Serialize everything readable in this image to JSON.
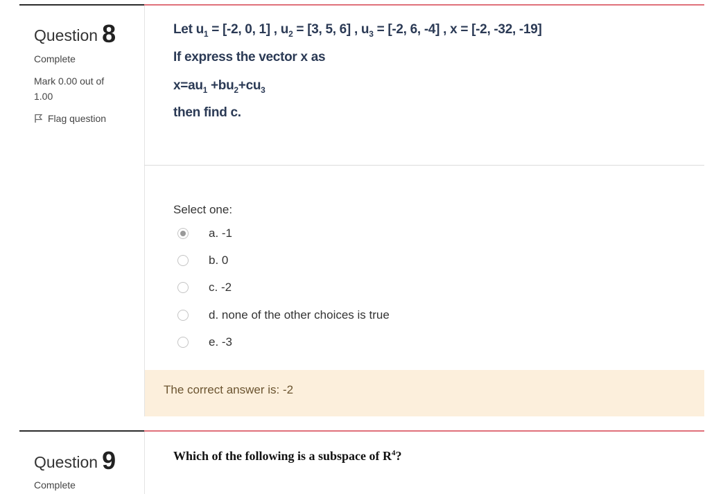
{
  "question8": {
    "label": "Question",
    "number": "8",
    "status": "Complete",
    "mark": "Mark 0.00 out of",
    "mark_total": "1.00",
    "flag_label": "Flag question",
    "text": {
      "line1_prefix": "Let u",
      "line1_sub1": "1",
      "line1_mid1": " = [-2, 0, 1] , u",
      "line1_sub2": "2",
      "line1_mid2": " = [3, 5, 6] , u",
      "line1_sub3": "3",
      "line1_mid3": " = [-2, 6, -4] , x = [-2, -32, -19]",
      "line2": "If express the vector x as",
      "line3_a": "x=au",
      "line3_sub1": "1",
      "line3_b": " +bu",
      "line3_sub2": "2",
      "line3_c": "+cu",
      "line3_sub3": "3",
      "line4": "then find c."
    },
    "select_prompt": "Select one:",
    "options": [
      {
        "label": "a. -1",
        "checked": true
      },
      {
        "label": "b. 0",
        "checked": false
      },
      {
        "label": "c. -2",
        "checked": false
      },
      {
        "label": "d. none of the other choices is true",
        "checked": false
      },
      {
        "label": "e. -3",
        "checked": false
      }
    ],
    "feedback": "The correct answer is: -2"
  },
  "question9": {
    "label": "Question",
    "number": "9",
    "status": "Complete",
    "text_main": "Which of the following is a subspace of R",
    "text_sup": "4",
    "text_end": "?"
  },
  "colors": {
    "accent_rule": "#e0707a",
    "feedback_bg": "#fcefdc",
    "question_text": "#2b3a55"
  }
}
